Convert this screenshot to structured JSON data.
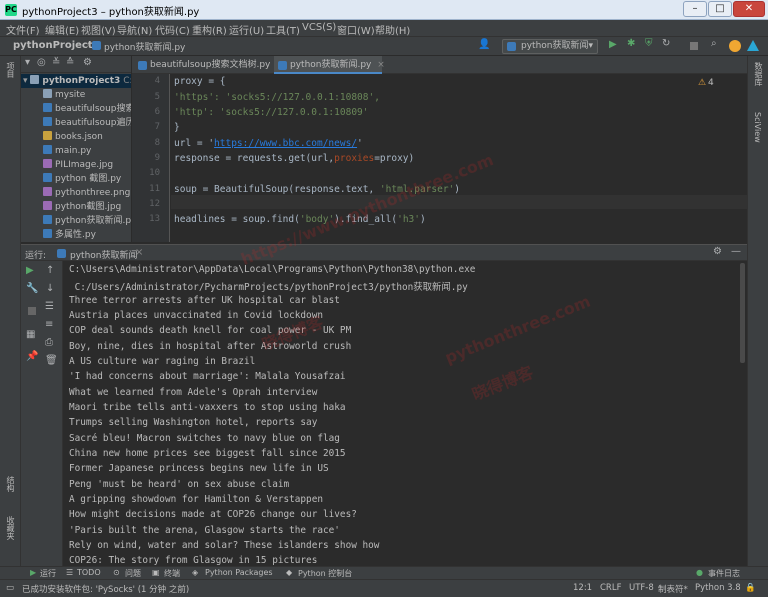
{
  "window": {
    "title": "pythonProject3 – python获取新闻.py",
    "min": "–",
    "max": "□",
    "close": "✕"
  },
  "menu": [
    "文件(F)",
    "编辑(E)",
    "视图(V)",
    "导航(N)",
    "代码(C)",
    "重构(R)",
    "运行(U)",
    "工具(T)",
    "VCS(S)",
    "窗口(W)",
    "帮助(H)"
  ],
  "nav": {
    "project": "pythonProject3",
    "file": "python获取新闻.py",
    "run_config": "python获取新闻"
  },
  "project_tree": {
    "root": "pythonProject3",
    "root_path": "C:\\U",
    "items": [
      "mysite",
      "beautifulsoup搜索文",
      "beautifulsoup遍历文",
      "books.json",
      "main.py",
      "PILImage.jpg",
      "python 截图.py",
      "pythonthree.png",
      "python截图.jpg",
      "python获取新闻.py",
      "多属性.py"
    ]
  },
  "tabs": [
    "beautifulsoup搜索文档树.py",
    "python获取新闻.py"
  ],
  "editor": {
    "warnings": "4",
    "line_numbers": [
      "4",
      "5",
      "6",
      "7",
      "8",
      "9",
      "10",
      "11",
      "12",
      "13"
    ],
    "line1": "proxy = {",
    "line2_key": "'https'",
    "line2_val": ": 'socks5://127.0.0.1:10808',",
    "line3_key": "'http'",
    "line3_val": ": 'socks5://127.0.0.1:10809'",
    "line4": "}",
    "line5_a": "url = '",
    "line5_url": "https://www.bbc.com/news/",
    "line5_b": "'",
    "line6_a": "response = requests.get(url,",
    "line6_kw": "proxies",
    "line6_b": "=proxy)",
    "line8_a": "soup = BeautifulSoup(response.text, ",
    "line8_s": "'html.parser'",
    "line8_b": ")",
    "line10_a": "headlines = soup.find(",
    "line10_s1": "'body'",
    "line10_b": ").find_all(",
    "line10_s2": "'h3'",
    "line10_c": ")"
  },
  "run": {
    "label": "运行:",
    "tab": "python获取新闻",
    "cmd1": "C:\\Users\\Administrator\\AppData\\Local\\Programs\\Python\\Python38\\python.exe",
    "cmd2": " C:/Users/Administrator/PycharmProjects/pythonProject3/python获取新闻.py",
    "output": [
      "Three terror arrests after UK hospital car blast",
      "Austria places unvaccinated in Covid lockdown",
      "COP deal sounds death knell for coal power - UK PM",
      "Boy, nine, dies in hospital after Astroworld crush",
      "A US culture war raging in Brazil",
      "'I had concerns about marriage': Malala Yousafzai",
      "What we learned from Adele's Oprah interview",
      "Maori tribe tells anti-vaxxers to stop using haka",
      "Trumps selling Washington hotel, reports say",
      "Sacré bleu! Macron switches to navy blue on flag",
      "China new home prices see biggest fall since 2015",
      "Former Japanese princess begins new life in US",
      "Peng 'must be heard' on sex abuse claim",
      "A gripping showdown for Hamilton & Verstappen",
      "How might decisions made at COP26 change our lives?",
      "'Paris built the arena, Glasgow starts the race'",
      "Rely on wind, water and solar? These islanders show how",
      "COP26: The story from Glasgow in 15 pictures"
    ]
  },
  "side": {
    "left_top": "项目",
    "left_struct": "结构",
    "left_fav": "收藏夹",
    "right_db": "数据库",
    "right_sciview": "SciView"
  },
  "bottom_tabs": [
    "运行",
    "TODO",
    "问题",
    "终端",
    "Python Packages",
    "Python 控制台"
  ],
  "event_log": "事件日志",
  "status": {
    "message": "已成功安装软件包: 'PySocks' (1 分钟 之前)",
    "position": "12:1",
    "line_sep": "CRLF",
    "encoding": "UTF-8",
    "indent": "制表符*",
    "interpreter": "Python 3.8"
  },
  "watermarks": [
    "https://www.pythonthree.com",
    "晓得博客",
    "pythonthree.com",
    "晓得博客"
  ],
  "colors": {
    "string": "#6a8759",
    "keyword": "#cc7832",
    "url": "#287bde",
    "accent": "#4a88c7"
  }
}
